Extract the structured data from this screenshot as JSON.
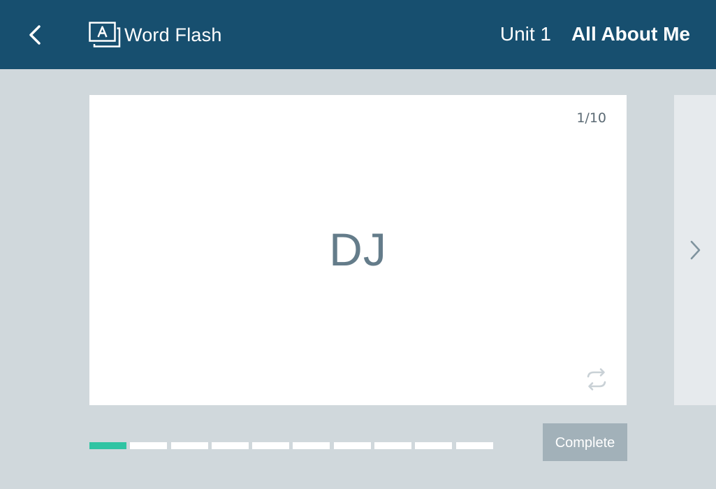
{
  "header": {
    "app_title": "Word Flash",
    "unit_label": "Unit 1",
    "unit_title": "All About Me",
    "back_icon": "chevron-left-icon",
    "logo_icon": "word-flash-logo-icon"
  },
  "card": {
    "counter": "1/10",
    "word": "DJ",
    "flip_icon": "flip-icon"
  },
  "next_card": {
    "arrow_icon": "chevron-right-icon"
  },
  "progress": {
    "current": 1,
    "total": 10
  },
  "actions": {
    "complete_label": "Complete"
  },
  "colors": {
    "header_bg": "#174f6f",
    "page_bg": "#d0d8dc",
    "progress_active": "#2fc4a3",
    "complete_button": "#a2b1b9",
    "word_text": "#647c8a"
  }
}
